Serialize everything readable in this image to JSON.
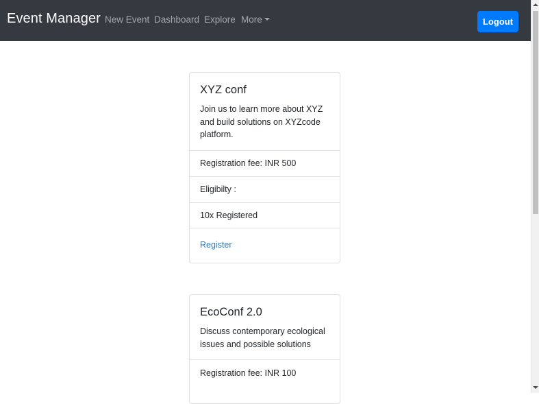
{
  "navbar": {
    "brand": "Event Manager",
    "links": [
      "New Event",
      "Dashboard",
      "Explore",
      "More"
    ],
    "logout_label": "Logout"
  },
  "events": [
    {
      "title": "XYZ conf",
      "description": "Join us to learn more about XYZ and build solutions on XYZcode platform.",
      "fee": "Registration fee: INR 500",
      "eligibility": "Eligibilty :",
      "registered": "10x Registered",
      "action": "Register"
    },
    {
      "title": "EcoConf 2.0",
      "description": "Discuss contemporary ecological issues and possible solutions",
      "fee": "Registration fee: INR 100"
    }
  ],
  "colors": {
    "navbar_bg": "#343a40",
    "primary": "#007bff",
    "link": "#337ab7"
  }
}
